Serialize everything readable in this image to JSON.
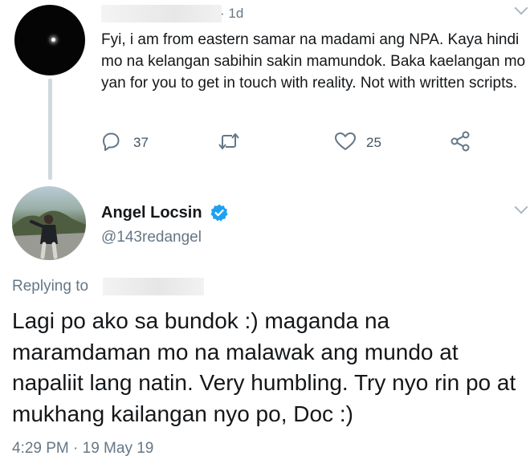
{
  "parent_tweet": {
    "time_separator": "·",
    "time_ago": "1d",
    "text": "Fyi, i am from eastern samar na madami ang NPA. Kaya hindi mo na kelangan sabihin sakin mamundok. Baka kaelangan mo yan for you to get in touch with reality. Not with written scripts.",
    "reply_count": "37",
    "like_count": "25",
    "icons": [
      "reply-icon",
      "retweet-icon",
      "like-icon",
      "share-icon"
    ]
  },
  "reply_tweet": {
    "name": "Angel Locsin",
    "handle": "@143redangel",
    "replying_label": "Replying to",
    "text": "Lagi po ako sa bundok :) maganda na maramdaman mo na malawak ang mundo at napaliit lang natin. Very humbling. Try nyo rin po at mukhang kailangan nyo po, Doc :)",
    "timestamp": "4:29 PM · 19 May 19",
    "verified_color": "#1da1f2"
  },
  "colors": {
    "text_primary": "#14171a",
    "text_secondary": "#657786",
    "thread_line": "#cfd9de",
    "background": "#ffffff"
  }
}
